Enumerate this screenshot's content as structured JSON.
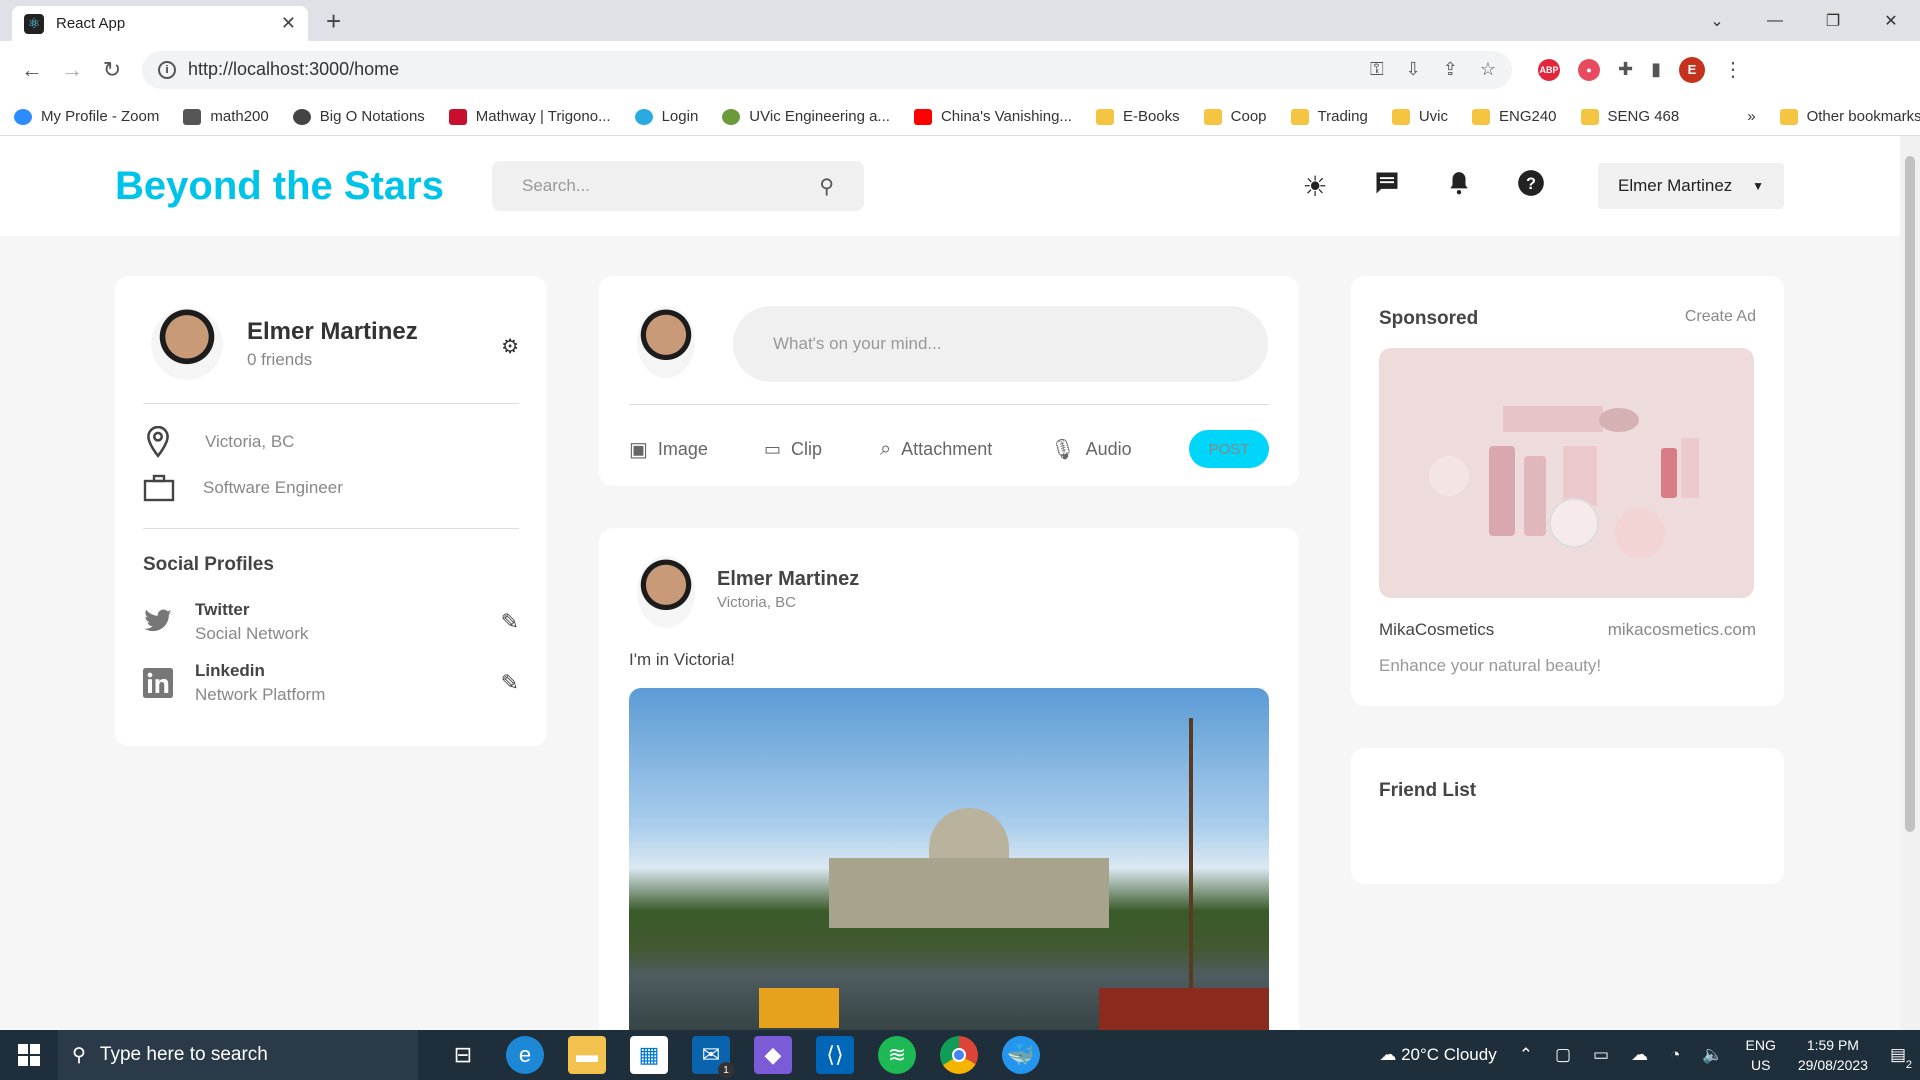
{
  "browser": {
    "tab_title": "React App",
    "url": "http://localhost:3000/home",
    "profile_initial": "E",
    "bookmarks": [
      "My Profile - Zoom",
      "math200",
      "Big O Notations",
      "Mathway | Trigono...",
      "Login",
      "UVic Engineering a...",
      "China's Vanishing...",
      "E-Books",
      "Coop",
      "Trading",
      "Uvic",
      "ENG240",
      "SENG 468"
    ],
    "bookmark_overflow": "»",
    "other_bookmarks": "Other bookmarks"
  },
  "app": {
    "logo": "Beyond the Stars",
    "search_placeholder": "Search...",
    "user_menu": "Elmer Martinez"
  },
  "profile": {
    "name": "Elmer Martinez",
    "friends": "0 friends",
    "location": "Victoria, BC",
    "occupation": "Software Engineer",
    "social_title": "Social Profiles",
    "socials": [
      {
        "name": "Twitter",
        "type": "Social Network"
      },
      {
        "name": "Linkedin",
        "type": "Network Platform"
      }
    ]
  },
  "composer": {
    "placeholder": "What's on your mind...",
    "actions": [
      "Image",
      "Clip",
      "Attachment",
      "Audio"
    ],
    "post_label": "POST"
  },
  "post": {
    "author": "Elmer Martinez",
    "location": "Victoria, BC",
    "text": "I'm in Victoria!"
  },
  "sponsored": {
    "title": "Sponsored",
    "create_ad": "Create Ad",
    "brand": "MikaCosmetics",
    "site": "mikacosmetics.com",
    "tagline": "Enhance your natural beauty!"
  },
  "friend_list": {
    "title": "Friend List"
  },
  "taskbar": {
    "search_placeholder": "Type here to search",
    "weather": "20°C  Cloudy",
    "lang_top": "ENG",
    "lang_bottom": "US",
    "time": "1:59 PM",
    "date": "29/08/2023",
    "notif_count": "2",
    "mail_count": "1"
  },
  "colors": {
    "accent": "#00c3ea"
  }
}
